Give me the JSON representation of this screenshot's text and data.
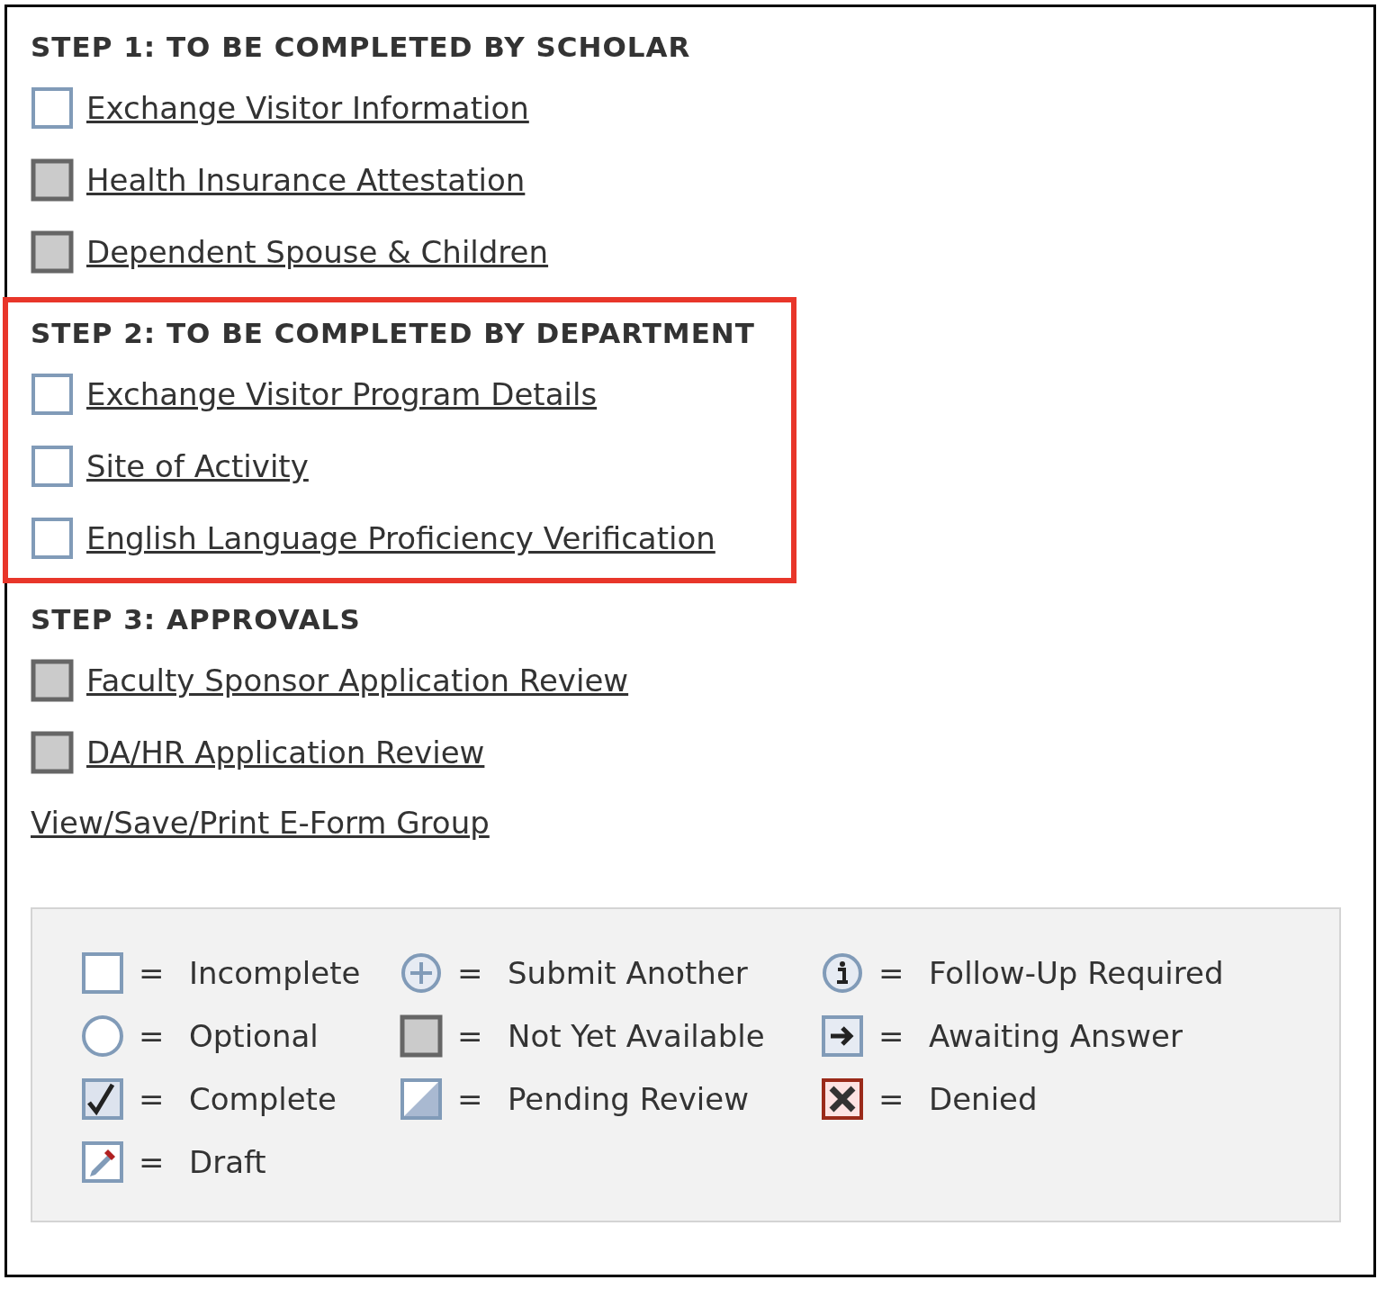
{
  "steps": [
    {
      "title": "STEP 1: TO BE COMPLETED BY SCHOLAR",
      "highlighted": false,
      "items": [
        {
          "label": "Exchange Visitor Information",
          "kind": "incomplete"
        },
        {
          "label": "Health Insurance Attestation",
          "kind": "unavailable"
        },
        {
          "label": "Dependent Spouse & Children",
          "kind": "unavailable"
        }
      ]
    },
    {
      "title": "STEP 2: TO BE COMPLETED BY DEPARTMENT",
      "highlighted": true,
      "items": [
        {
          "label": "Exchange Visitor Program Details",
          "kind": "incomplete"
        },
        {
          "label": "Site of Activity",
          "kind": "incomplete"
        },
        {
          "label": "English Language Proficiency Verification",
          "kind": "incomplete"
        }
      ]
    },
    {
      "title": "STEP 3: APPROVALS",
      "highlighted": false,
      "items": [
        {
          "label": "Faculty Sponsor Application Review",
          "kind": "unavailable"
        },
        {
          "label": "DA/HR Application Review",
          "kind": "unavailable"
        }
      ]
    }
  ],
  "group_link": "View/Save/Print E-Form Group",
  "legend": {
    "columns": [
      [
        {
          "kind": "incomplete",
          "sign": "=",
          "label": "Incomplete"
        },
        {
          "kind": "optional",
          "sign": "=",
          "label": "Optional"
        },
        {
          "kind": "complete",
          "sign": "=",
          "label": "Complete"
        },
        {
          "kind": "draft",
          "sign": "=",
          "label": "Draft"
        }
      ],
      [
        {
          "kind": "another",
          "sign": "=",
          "label": "Submit Another"
        },
        {
          "kind": "unavailable",
          "sign": "=",
          "label": "Not Yet Available"
        },
        {
          "kind": "pending",
          "sign": "=",
          "label": "Pending Review"
        }
      ],
      [
        {
          "kind": "followup",
          "sign": "=",
          "label": "Follow-Up Required"
        },
        {
          "kind": "awaiting",
          "sign": "=",
          "label": "Awaiting Answer"
        },
        {
          "kind": "denied",
          "sign": "=",
          "label": "Denied"
        }
      ]
    ]
  }
}
